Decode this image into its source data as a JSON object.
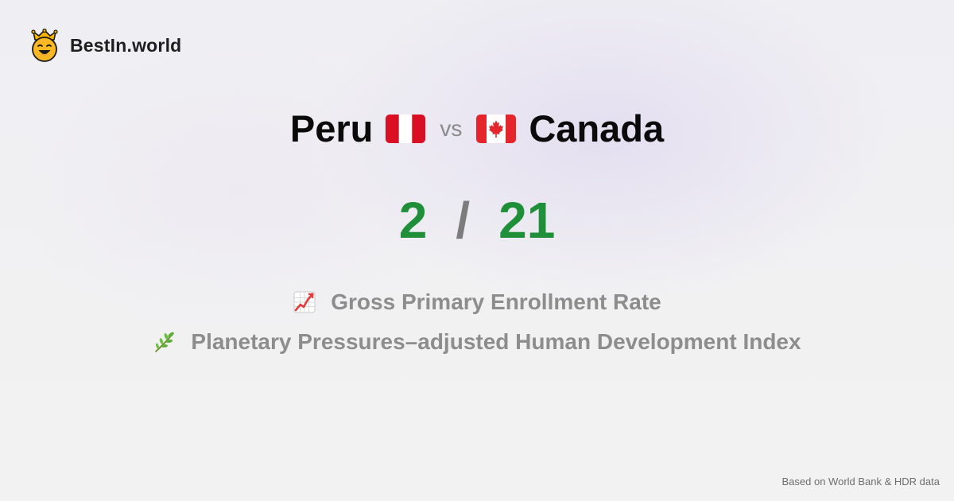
{
  "brand": {
    "name": "BestIn.world",
    "icon": "crowned-smiley-icon"
  },
  "comparison": {
    "left_country": "Peru",
    "left_flag": "peru-flag-icon",
    "separator": "vs",
    "right_country": "Canada",
    "right_flag": "canada-flag-icon"
  },
  "score": {
    "left": "2",
    "divider": "/",
    "right": "21",
    "color": "#1f8f3a"
  },
  "metrics": [
    {
      "icon": "chart-increasing-icon",
      "label": "Gross Primary Enrollment Rate"
    },
    {
      "icon": "herb-icon",
      "label": "Planetary Pressures–adjusted Human Development Index"
    }
  ],
  "footer": {
    "source": "Based on World Bank & HDR data"
  },
  "colors": {
    "peru_red": "#d91023",
    "canada_red": "#e4262c",
    "muted_text": "#8d8d8d"
  }
}
